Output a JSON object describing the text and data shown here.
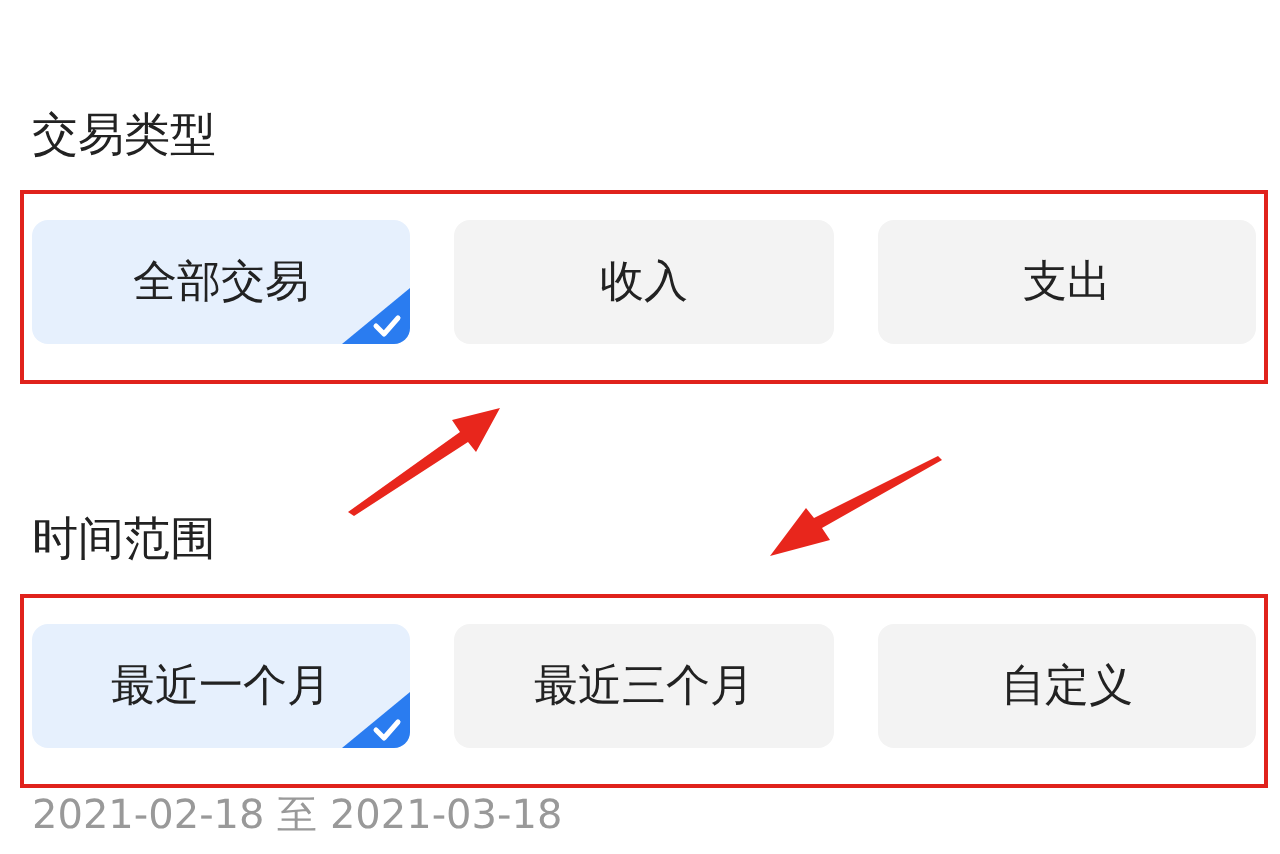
{
  "sections": [
    {
      "title": "交易类型",
      "options": [
        {
          "label": "全部交易",
          "selected": true
        },
        {
          "label": "收入",
          "selected": false
        },
        {
          "label": "支出",
          "selected": false
        }
      ]
    },
    {
      "title": "时间范围",
      "options": [
        {
          "label": "最近一个月",
          "selected": true
        },
        {
          "label": "最近三个月",
          "selected": false
        },
        {
          "label": "自定义",
          "selected": false
        }
      ],
      "range": "2021-02-18 至 2021-03-18"
    }
  ]
}
